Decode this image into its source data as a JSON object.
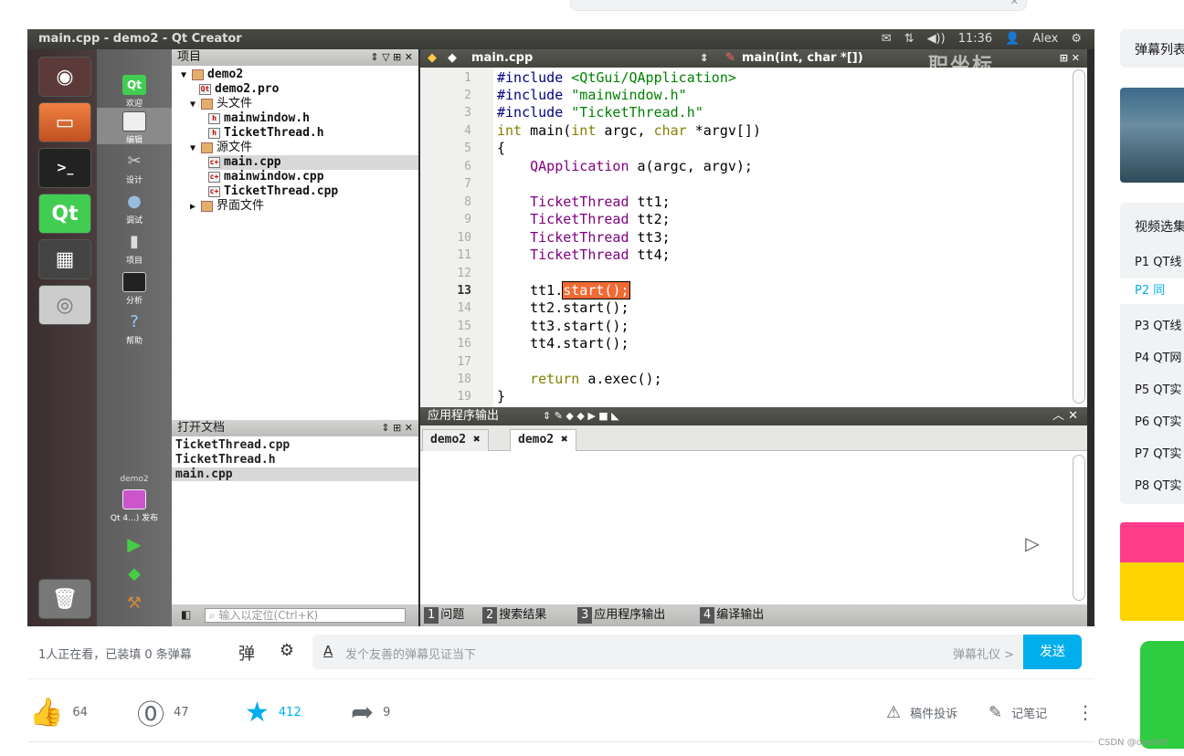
{
  "top_search": {
    "clear_icon": "close-icon"
  },
  "qt": {
    "window_title": "main.cpp - demo2 - Qt Creator",
    "tray": {
      "time": "11:36",
      "user": "Alex"
    },
    "watermark": "职坐标",
    "modes": [
      "欢迎",
      "编辑",
      "设计",
      "调试",
      "项目",
      "分析",
      "帮助"
    ],
    "kit_name": "demo2",
    "kit_label": "Qt 4...) 发布",
    "project_header": "项目",
    "tree": [
      {
        "label": "demo2",
        "indent": 0,
        "arrow": "▼",
        "icon": "folder"
      },
      {
        "label": "demo2.pro",
        "indent": 2,
        "arrow": "",
        "icon": "pro"
      },
      {
        "label": "头文件",
        "indent": 1,
        "arrow": "▼",
        "icon": "folder"
      },
      {
        "label": "mainwindow.h",
        "indent": 3,
        "arrow": "",
        "icon": "h"
      },
      {
        "label": "TicketThread.h",
        "indent": 3,
        "arrow": "",
        "icon": "h"
      },
      {
        "label": "源文件",
        "indent": 1,
        "arrow": "▼",
        "icon": "folder"
      },
      {
        "label": "main.cpp",
        "indent": 3,
        "arrow": "",
        "icon": "cpp"
      },
      {
        "label": "mainwindow.cpp",
        "indent": 3,
        "arrow": "",
        "icon": "cpp"
      },
      {
        "label": "TicketThread.cpp",
        "indent": 3,
        "arrow": "",
        "icon": "cpp"
      },
      {
        "label": "界面文件",
        "indent": 1,
        "arrow": "▶",
        "icon": "folder"
      }
    ],
    "open_docs_header": "打开文档",
    "open_docs": [
      "TicketThread.cpp",
      "TicketThread.h",
      "main.cpp"
    ],
    "locator_placeholder": "输入以定位(Ctrl+K)",
    "editor_file": "main.cpp",
    "editor_symbol": "main(int, char *[])",
    "line_numbers": [
      "1",
      "2",
      "3",
      "4",
      "5",
      "6",
      "7",
      "8",
      "9",
      "10",
      "11",
      "12",
      "13",
      "14",
      "15",
      "16",
      "17",
      "18",
      "19"
    ],
    "current_line": "13",
    "code": {
      "l1_kw": "#include",
      "l1_rest": " <QtGui/QApplication>",
      "l2_kw": "#include",
      "l2_rest": " \"mainwindow.h\"",
      "l3_kw": "#include",
      "l3_rest": " \"TicketThread.h\"",
      "l4_a": "int",
      "l4_b": " main(",
      "l4_c": "int",
      "l4_d": " argc, ",
      "l4_e": "char",
      "l4_f": " *argv[])",
      "l5": "{",
      "l6_a": "    QApplication",
      "l6_b": " a(argc, argv);",
      "l8_a": "    TicketThread",
      "l8_b": " tt1;",
      "l9_a": "    TicketThread",
      "l9_b": " tt2;",
      "l10_a": "    TicketThread",
      "l10_b": " tt3;",
      "l11_a": "    TicketThread",
      "l11_b": " tt4;",
      "l13_a": "    tt1.",
      "l13_b": "start();",
      "l14": "    tt2.start();",
      "l15": "    tt3.start();",
      "l16": "    tt4.start();",
      "l18_a": "    return",
      "l18_b": " a.exec();",
      "l19": "}"
    },
    "output_header": "应用程序输出",
    "output_tabs": [
      "demo2 ✖",
      "demo2 ✖"
    ],
    "bottom_tabs": [
      {
        "n": "1",
        "label": "问题"
      },
      {
        "n": "2",
        "label": "搜索结果"
      },
      {
        "n": "3",
        "label": "应用程序输出"
      },
      {
        "n": "4",
        "label": "编译输出"
      }
    ]
  },
  "danmu": {
    "viewers": "1人正在看，已装填 0 条弹幕",
    "input_icon": "A",
    "placeholder": "发个友善的弹幕见证当下",
    "etiquette": "弹幕礼仪 >",
    "send": "发送"
  },
  "actions": {
    "like": "64",
    "coin": "47",
    "favorite": "412",
    "share": "9",
    "report": "稿件投诉",
    "notes": "记笔记"
  },
  "sidebar": {
    "danmu_list": "弹幕列表",
    "episodes_title": "视频选集",
    "episodes": [
      "P1  QT线",
      "P2  同",
      "P3  QT线",
      "P4  QT网",
      "P5  QT实",
      "P6  QT实",
      "P7  QT实",
      "P8  QT实"
    ],
    "current_index": 1
  },
  "csdn_watermark": "CSDN @ooolmf",
  "colors": {
    "accent": "#00aeec",
    "selection": "#f26a33"
  }
}
